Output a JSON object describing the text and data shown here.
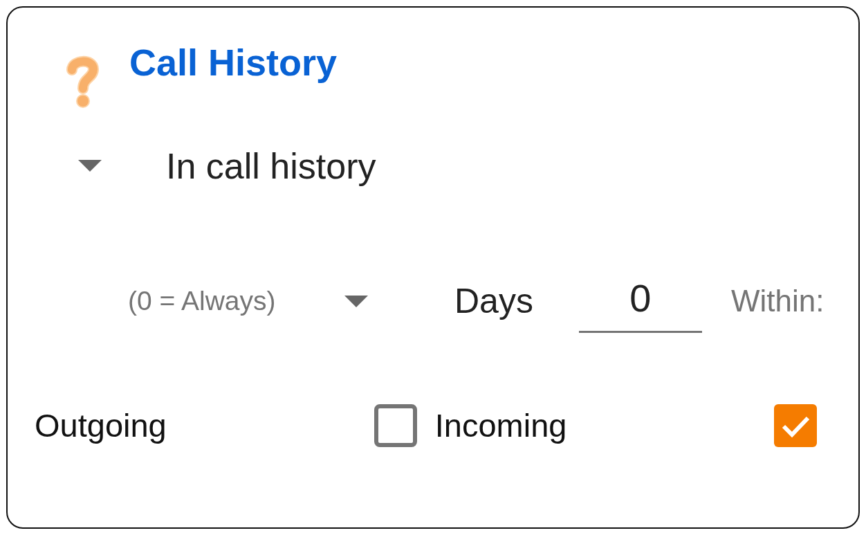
{
  "header": {
    "title": "Call History"
  },
  "filter": {
    "label": "In call history"
  },
  "period": {
    "hint": "(0 = Always)",
    "unit": "Days",
    "value": "0",
    "label": "Within:"
  },
  "options": [
    {
      "label": "Outgoing",
      "checked": false
    },
    {
      "label": "Incoming",
      "checked": true
    }
  ]
}
